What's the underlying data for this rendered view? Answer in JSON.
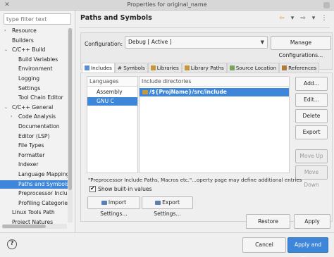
{
  "window": {
    "title": "Properties for original_name"
  },
  "filter": {
    "placeholder": "type filter text"
  },
  "tree": [
    {
      "label": "Resource",
      "arrow": "›"
    },
    {
      "label": "Builders",
      "arrow": ""
    },
    {
      "label": "C/C++ Build",
      "arrow": "⌄"
    },
    {
      "label": "Build Variables",
      "arrow": ""
    },
    {
      "label": "Environment",
      "arrow": ""
    },
    {
      "label": "Logging",
      "arrow": ""
    },
    {
      "label": "Settings",
      "arrow": ""
    },
    {
      "label": "Tool Chain Editor",
      "arrow": ""
    },
    {
      "label": "C/C++ General",
      "arrow": "⌄"
    },
    {
      "label": "Code Analysis",
      "arrow": "›"
    },
    {
      "label": "Documentation",
      "arrow": ""
    },
    {
      "label": "Editor (LSP)",
      "arrow": ""
    },
    {
      "label": "File Types",
      "arrow": ""
    },
    {
      "label": "Formatter",
      "arrow": ""
    },
    {
      "label": "Indexer",
      "arrow": ""
    },
    {
      "label": "Language Mappings",
      "arrow": ""
    },
    {
      "label": "Paths and Symbols",
      "arrow": ""
    },
    {
      "label": "Preprocessor Incluc",
      "arrow": ""
    },
    {
      "label": "Profiling Categories",
      "arrow": ""
    },
    {
      "label": "Linux Tools Path",
      "arrow": ""
    },
    {
      "label": "Project Natures",
      "arrow": ""
    }
  ],
  "page": {
    "title": "Paths and Symbols"
  },
  "config": {
    "label": "Configuration:",
    "value": "Debug  [ Active ]",
    "manage_label": "Manage Configurations..."
  },
  "tabs": [
    {
      "label": "Includes",
      "icon": "includes-icon"
    },
    {
      "label": "# Symbols",
      "icon": "symbols-icon"
    },
    {
      "label": "Libraries",
      "icon": "libraries-icon"
    },
    {
      "label": "Library Paths",
      "icon": "library-paths-icon"
    },
    {
      "label": "Source Location",
      "icon": "source-location-icon"
    },
    {
      "label": "References",
      "icon": "references-icon"
    }
  ],
  "languages": {
    "header": "Languages",
    "items": [
      "Assembly",
      "GNU C"
    ]
  },
  "directories": {
    "header": "Include directories",
    "items": [
      "/${ProjName}/src/include"
    ]
  },
  "buttons": {
    "add": "Add...",
    "edit": "Edit...",
    "delete": "Delete",
    "export": "Export",
    "move_up": "Move Up",
    "move_down": "Move Down",
    "import_settings": "Import Settings...",
    "export_settings": "Export Settings...",
    "restore_defaults": "Restore Defaults",
    "apply": "Apply",
    "cancel": "Cancel",
    "apply_close": "Apply and Close"
  },
  "info_text": "\"Preprocessor Include Paths, Macros etc.\"...operty page may define additional entries",
  "show_builtin": {
    "label": "Show built-in values",
    "checked": true
  },
  "colors": {
    "accent": "#3d86d9"
  }
}
